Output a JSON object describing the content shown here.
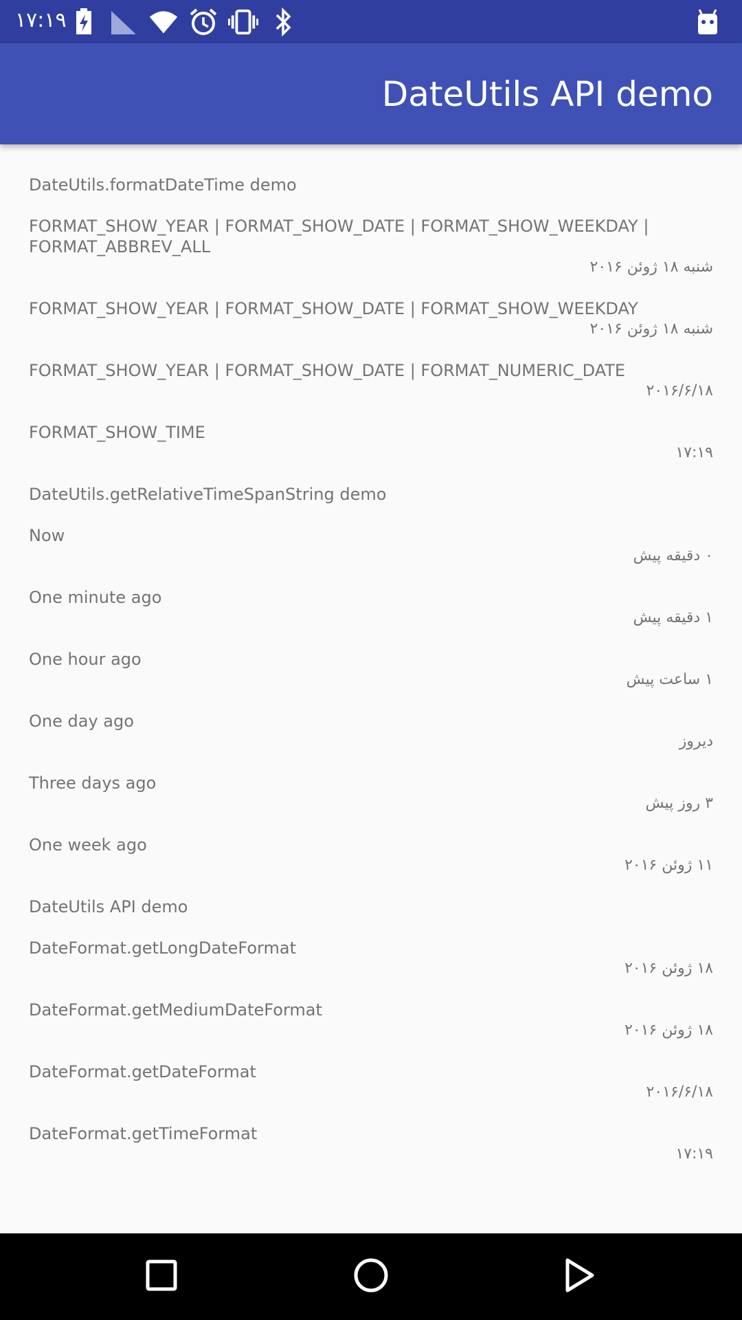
{
  "status_bar": {
    "time": "۱۷:۱۹",
    "icons": [
      "battery-charging-icon",
      "cell-signal-icon",
      "wifi-icon",
      "alarm-icon",
      "vibrate-icon",
      "bluetooth-icon",
      "android-debug-icon"
    ]
  },
  "app_bar": {
    "title": "DateUtils API demo"
  },
  "sections": {
    "format_header": "DateUtils.formatDateTime demo",
    "relative_header": "DateUtils.getRelativeTimeSpanString demo",
    "api_header": "DateUtils API demo"
  },
  "format_rows": [
    {
      "label": "FORMAT_SHOW_YEAR | FORMAT_SHOW_DATE | FORMAT_SHOW_WEEKDAY |\nFORMAT_ABBREV_ALL",
      "value": "شنبه ۱۸ ژوئن ۲۰۱۶"
    },
    {
      "label": "FORMAT_SHOW_YEAR | FORMAT_SHOW_DATE | FORMAT_SHOW_WEEKDAY",
      "value": "شنبه ۱۸ ژوئن ۲۰۱۶"
    },
    {
      "label": "FORMAT_SHOW_YEAR | FORMAT_SHOW_DATE | FORMAT_NUMERIC_DATE",
      "value": "۲۰۱۶/۶/۱۸"
    },
    {
      "label": "FORMAT_SHOW_TIME",
      "value": "۱۷:۱۹"
    }
  ],
  "relative_rows": [
    {
      "label": "Now",
      "value": "۰ دقیقه پیش"
    },
    {
      "label": "One minute ago",
      "value": "۱ دقیقه پیش"
    },
    {
      "label": "One hour ago",
      "value": "۱ ساعت پیش"
    },
    {
      "label": "One day ago",
      "value": "دیروز"
    },
    {
      "label": "Three days ago",
      "value": "۳ روز پیش"
    },
    {
      "label": "One week ago",
      "value": "۱۱ ژوئن ۲۰۱۶"
    }
  ],
  "api_rows": [
    {
      "label": "DateFormat.getLongDateFormat",
      "value": "۱۸ ژوئن ۲۰۱۶"
    },
    {
      "label": "DateFormat.getMediumDateFormat",
      "value": "۱۸ ژوئن ۲۰۱۶"
    },
    {
      "label": "DateFormat.getDateFormat",
      "value": "۲۰۱۶/۶/۱۸"
    },
    {
      "label": "DateFormat.getTimeFormat",
      "value": "۱۷:۱۹"
    }
  ],
  "nav_bar": {
    "buttons": [
      "recents-square-icon",
      "home-circle-icon",
      "back-triangle-icon"
    ]
  }
}
